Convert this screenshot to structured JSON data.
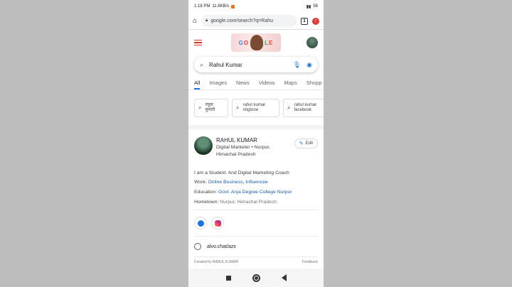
{
  "status": {
    "time": "1:18 PM",
    "speed": "11.8KB/s",
    "battery": "56"
  },
  "browser": {
    "url": "google.com/search?q=Rahu",
    "tab_count": "1"
  },
  "search": {
    "query": "Rahul Kumar"
  },
  "tabs": [
    "All",
    "Images",
    "News",
    "Videos",
    "Maps",
    "Shopp"
  ],
  "chips": [
    "राहुल\nकुमारी",
    "rahul kumar\nringtone",
    "rahul kumar\nfacebook"
  ],
  "profile": {
    "name": "RAHUL KUMAR",
    "desc": "Digital Marketer • Nurpur, Himachal Pradesh",
    "edit_label": "Edit",
    "bio": "I am a Student. And Digital Marketing Coach",
    "work_label": "Work:",
    "work_value": "Online Business, Influencee",
    "education_label": "Education:",
    "education_value": "Govt. Arya Degree College Nurpur",
    "hometown_label": "Hometown:",
    "hometown_value": "Nurpur, Himachal Pradesh",
    "link": "alvo.chat/azx",
    "created_by": "Created by RAHUL KUMAR",
    "feedback": "Feedback"
  },
  "doodle_text": "GOOGLE",
  "colors": {
    "accent": "#1a73e8",
    "hamburger": "#d93025",
    "link": "#1a5bb5"
  }
}
